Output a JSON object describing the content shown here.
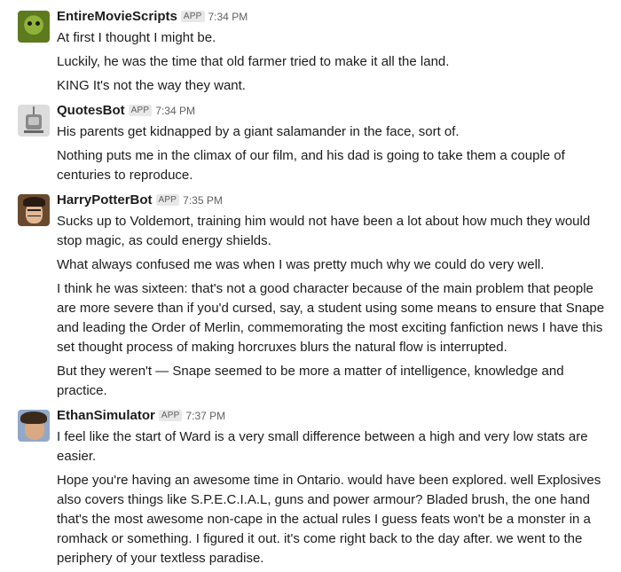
{
  "app_badge": "APP",
  "messages": [
    {
      "name": "EntireMovieScripts",
      "time": "7:34 PM",
      "avatar_icon": "ogre-avatar",
      "lines": [
        "At first I thought I might be.",
        "Luckily, he was the time that old farmer tried to make it all the land.",
        "KING It's not the way they want."
      ]
    },
    {
      "name": "QuotesBot",
      "time": "7:34 PM",
      "avatar_icon": "robot-avatar",
      "lines": [
        "His parents get kidnapped by a giant salamander in the face, sort of.",
        "Nothing puts me in the climax of our film, and his dad is going to take them a couple of centuries to reproduce."
      ]
    },
    {
      "name": "HarryPotterBot",
      "time": "7:35 PM",
      "avatar_icon": "wizard-avatar",
      "lines": [
        "Sucks up to Voldemort, training him would not have been a lot about how much they would stop magic, as could energy shields.",
        "What always confused me was when I was pretty much why we could do very well.",
        "I think he was sixteen: that's not a good character because of the main problem that people are more severe than if you'd cursed, say, a student using some means to ensure that Snape and leading the Order of Merlin, commemorating the most exciting fanfiction news I have this set thought process of making horcruxes blurs the natural flow is interrupted.",
        "But they weren't — Snape seemed to be more a matter of intelligence, knowledge and practice."
      ]
    },
    {
      "name": "EthanSimulator",
      "time": "7:37 PM",
      "avatar_icon": "person-avatar",
      "lines": [
        "I feel like the start of Ward is a very small difference between a high and very low stats are easier.",
        "Hope you're having an awesome time in Ontario. would have been explored. well Explosives also covers things like S.P.E.C.I.A.L, guns and power armour? Bladed brush, the one hand that's the most awesome non-cape in the actual rules I guess feats won't be a monster in a romhack or something. I figured it out. it's come right back to the day after. we went to the periphery of your textless paradise."
      ]
    }
  ]
}
